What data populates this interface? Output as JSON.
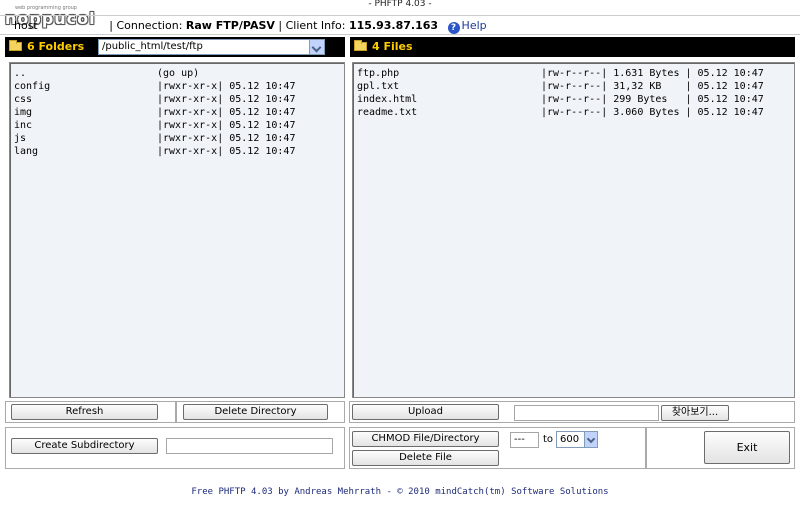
{
  "window": {
    "title": "- PHFTP 4.03 -"
  },
  "logo": {
    "mark": "noppucol",
    "sub": "web programming group"
  },
  "info": {
    "host_label": "host",
    "connection_label": "Connection:",
    "connection_value": "Raw FTP/PASV",
    "client_label": "Client Info:",
    "client_value": "115.93.87.163",
    "help_label": "Help"
  },
  "folders_panel": {
    "title": "6 Folders",
    "path": "/public_html/test/ftp",
    "rows": [
      {
        "name": "..",
        "info": "(go up)"
      },
      {
        "name": "config",
        "info": "|rwxr-xr-x| 05.12 10:47"
      },
      {
        "name": "css",
        "info": "|rwxr-xr-x| 05.12 10:47"
      },
      {
        "name": "img",
        "info": "|rwxr-xr-x| 05.12 10:47"
      },
      {
        "name": "inc",
        "info": "|rwxr-xr-x| 05.12 10:47"
      },
      {
        "name": "js",
        "info": "|rwxr-xr-x| 05.12 10:47"
      },
      {
        "name": "lang",
        "info": "|rwxr-xr-x| 05.12 10:47"
      }
    ]
  },
  "files_panel": {
    "title": "4 Files",
    "rows": [
      {
        "name": "ftp.php",
        "info": "|rw-r--r--| 1.631 Bytes | 05.12 10:47"
      },
      {
        "name": "gpl.txt",
        "info": "|rw-r--r--| 31,32 KB    | 05.12 10:47"
      },
      {
        "name": "index.html",
        "info": "|rw-r--r--| 299 Bytes   | 05.12 10:47"
      },
      {
        "name": "readme.txt",
        "info": "|rw-r--r--| 3.060 Bytes | 05.12 10:47"
      }
    ]
  },
  "actions": {
    "refresh": "Refresh",
    "delete_directory": "Delete Directory",
    "upload": "Upload",
    "browse": "찾아보기...",
    "create_subdirectory": "Create Subdirectory",
    "chmod": "CHMOD File/Directory",
    "delete_file": "Delete File",
    "chmod_from": "---",
    "chmod_to_label": "to",
    "chmod_to_value": "600",
    "exit": "Exit"
  },
  "footer": {
    "text": "Free PHFTP 4.03 by Andreas Mehrrath - © 2010 mindCatch(tm) Software Solutions"
  },
  "colors": {
    "header_bg": "#000000",
    "header_text": "#ffcc00",
    "list_bg": "#f0f4f8",
    "footer_text": "#1d2b7a"
  }
}
